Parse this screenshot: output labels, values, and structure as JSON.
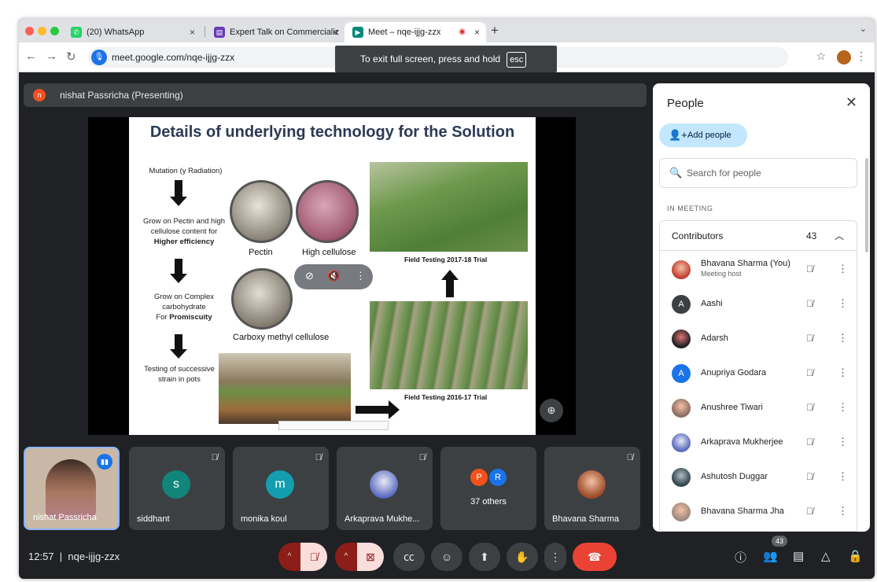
{
  "browser": {
    "tabs": [
      {
        "label": "(20) WhatsApp",
        "icon": "whatsapp-icon",
        "close": "×"
      },
      {
        "label": "Expert Talk on Commercializ",
        "icon": "forms-icon",
        "close": "×"
      },
      {
        "label": "Meet – nqe-ijjg-zzx",
        "icon": "meet-icon",
        "close": "×"
      }
    ],
    "new_tab": "+",
    "url": "meet.google.com/nqe-ijjg-zzx",
    "fullscreen_notice": "To exit full screen, press and hold",
    "fullscreen_key": "esc"
  },
  "presenter": {
    "avatar_letter": "n",
    "label": "nishat Passricha (Presenting)"
  },
  "slide": {
    "title": "Details of underlying technology for the Solution",
    "mutation": "Mutation (γ Radiation)",
    "grow_pectin_1": "Grow on Pectin and high",
    "grow_pectin_2": "cellulose content for",
    "grow_pectin_3": "Higher efficiency",
    "grow_complex_1": "Grow on Complex",
    "grow_complex_2": "carbohydrate",
    "grow_complex_3": "For",
    "grow_complex_4": "Promiscuity",
    "testing_1": "Testing of successive",
    "testing_2": "strain in pots",
    "pectin": "Pectin",
    "high_cellulose": "High cellulose",
    "cmc": "Carboxy methyl cellulose",
    "field_2017": "Field Testing 2017-18 Trial",
    "field_2016": "Field Testing 2016-17 Trial"
  },
  "participants": [
    {
      "name": "nishat Passricha",
      "self_view": true
    },
    {
      "name": "siddhant",
      "letter": "s",
      "color": "#12857a"
    },
    {
      "name": "monika koul",
      "letter": "m",
      "color": "#129eaf"
    },
    {
      "name": "Arkaprava Mukhe...",
      "photo": true
    },
    {
      "name": "",
      "others": "37 others",
      "letters": [
        "P",
        "R"
      ]
    },
    {
      "name": "Bhavana Sharma",
      "photo": true
    }
  ],
  "people_panel": {
    "title": "People",
    "add_people": "Add people",
    "search_placeholder": "Search for people",
    "section": "IN MEETING",
    "group_label": "Contributors",
    "group_count": "43",
    "people": [
      {
        "name": "Bhavana Sharma (You)",
        "sub": "Meeting host",
        "avatar": "photo",
        "color": "#c0392b"
      },
      {
        "name": "Aashi",
        "letter": "A",
        "color": "#3c4043"
      },
      {
        "name": "Adarsh",
        "avatar": "photo",
        "color": "#202124"
      },
      {
        "name": "Anupriya Godara",
        "letter": "A",
        "color": "#1a73e8"
      },
      {
        "name": "Anushree Tiwari",
        "avatar": "photo",
        "color": "#8d6e63"
      },
      {
        "name": "Arkaprava Mukherjee",
        "avatar": "photo",
        "color": "#5c6bc0"
      },
      {
        "name": "Ashutosh Duggar",
        "avatar": "photo",
        "color": "#37474f"
      },
      {
        "name": "Bhavana Sharma Jha",
        "avatar": "photo",
        "color": "#a1887f"
      }
    ]
  },
  "controls": {
    "time": "12:57",
    "meeting_code": "nqe-ijjg-zzx",
    "people_count": "43"
  },
  "colors": {
    "meet_bg": "#202124",
    "leave_red": "#ea4335",
    "muted_red": "#8c1d18",
    "accent_blue": "#1a73e8"
  }
}
